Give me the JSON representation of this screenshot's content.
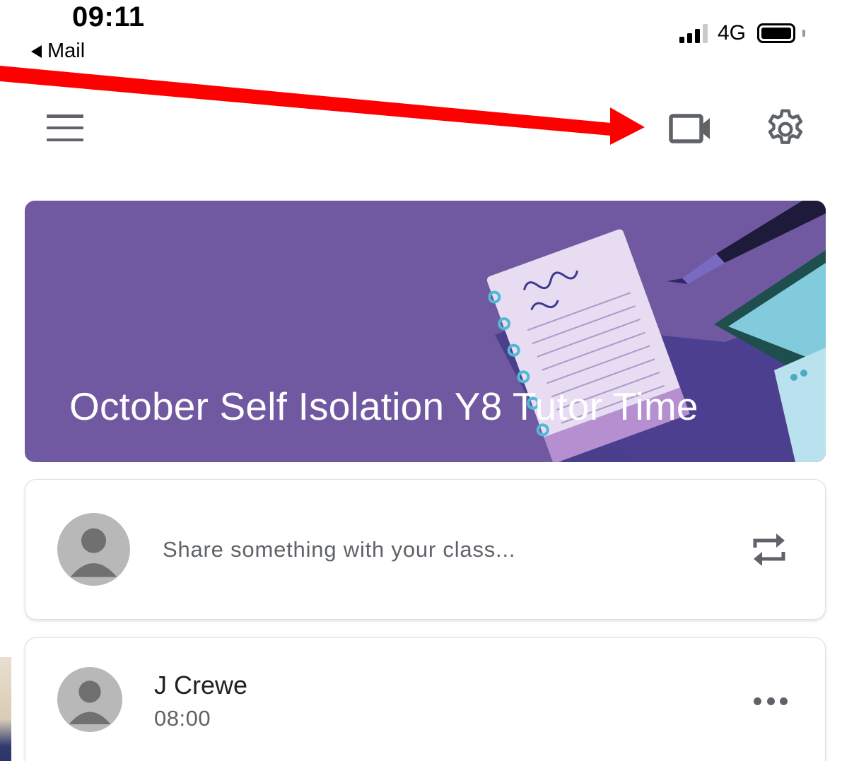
{
  "status_bar": {
    "time": "09:11",
    "back_label": "Mail",
    "network": "4G",
    "signal_bars_active": 3,
    "signal_bars_total": 4,
    "battery_level": 0.85
  },
  "app_bar": {
    "menu_icon": "hamburger-menu-icon",
    "meet_icon": "video-camera-icon",
    "settings_icon": "gear-icon"
  },
  "annotation": {
    "color": "#ff0000",
    "points_to": "video-camera-icon"
  },
  "banner": {
    "title": "October Self Isolation Y8 Tutor Time",
    "background": "#7059a1"
  },
  "share_box": {
    "placeholder": "Share something with your class...",
    "repost_icon": "repeat-icon",
    "avatar_icon": "default-avatar-icon"
  },
  "posts": [
    {
      "author": "J Crewe",
      "time": "08:00",
      "avatar_icon": "default-avatar-icon",
      "menu_icon": "more-horizontal-icon"
    }
  ]
}
